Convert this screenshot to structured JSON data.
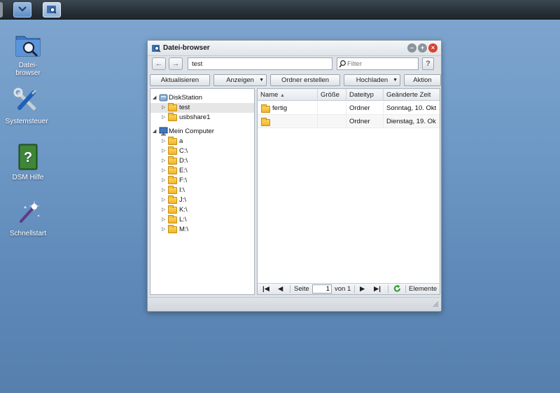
{
  "taskbar": {
    "buttons": [
      {
        "name": "main-menu-button",
        "icon": "chevron-down-icon"
      },
      {
        "name": "file-browser-taskbar-button",
        "icon": "file-browser-icon"
      }
    ]
  },
  "desktop": {
    "icons": [
      {
        "label": "Datei-\nbrowser",
        "icon": "file-browser-icon"
      },
      {
        "label": "Systemsteuer",
        "icon": "tools-icon"
      },
      {
        "label": "DSM Hilfe",
        "icon": "help-book-icon"
      },
      {
        "label": "Schnellstart",
        "icon": "magic-wand-icon"
      }
    ]
  },
  "window": {
    "title": "Datei-browser",
    "path_value": "test",
    "filter_placeholder": "Filter",
    "help_label": "?",
    "buttons": {
      "refresh": "Aktualisieren",
      "view": "Anzeigen",
      "create_folder": "Ordner erstellen",
      "upload": "Hochladen",
      "action": "Aktion"
    },
    "tree": {
      "diskstation": "DiskStation",
      "ds_items": [
        "test",
        "usbshare1"
      ],
      "computer": "Mein Computer",
      "pc_items": [
        "a",
        "C:\\",
        "D:\\",
        "E:\\",
        "F:\\",
        "I:\\",
        "J:\\",
        "K:\\",
        "L:\\",
        "M:\\"
      ]
    },
    "grid": {
      "columns": [
        "Name",
        "Größe",
        "Dateityp",
        "Geänderte Zeit"
      ],
      "rows": [
        {
          "name": "fertig",
          "size": "",
          "type": "Ordner",
          "modified": "Sonntag, 10. Okt"
        },
        {
          "name": "",
          "size": "",
          "type": "Ordner",
          "modified": "Dienstag, 19. Ok"
        }
      ]
    },
    "pager": {
      "page_label": "Seite",
      "page_value": "1",
      "of_label": "von 1",
      "items_label": "Elemente"
    }
  },
  "colors": {
    "desktop_bg": "#6f99c6",
    "taskbar_bg": "#2a333b",
    "close_button": "#d9412f",
    "folder": "#f0b32a",
    "refresh_green": "#2c9a2c"
  }
}
